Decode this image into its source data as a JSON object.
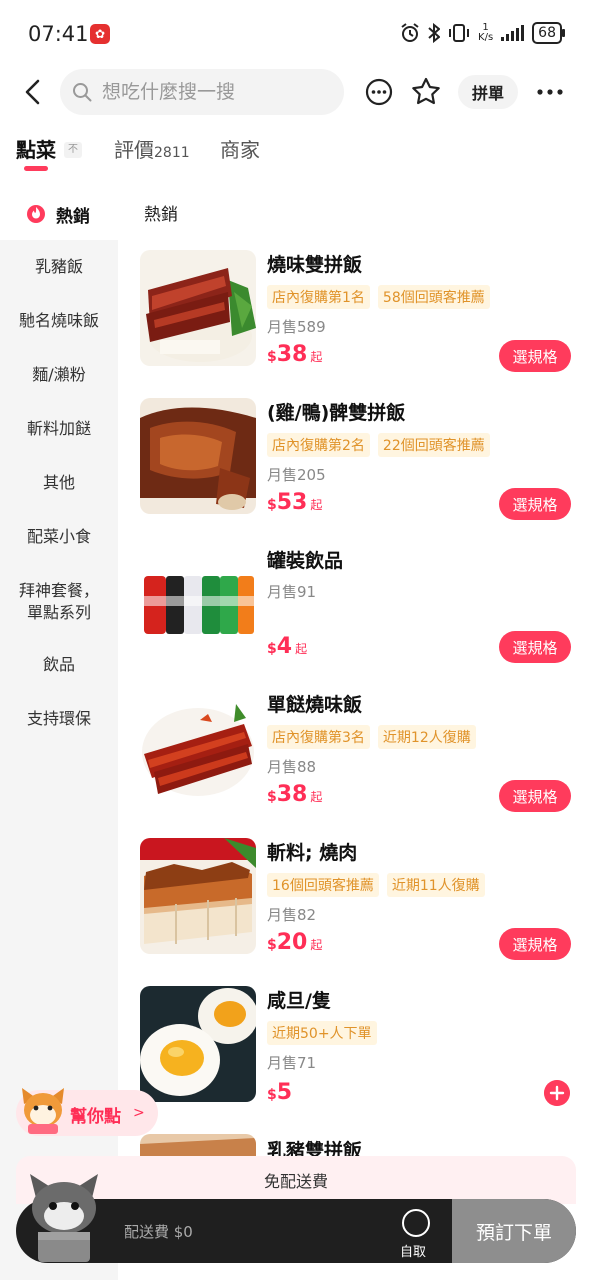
{
  "status": {
    "time": "07:41",
    "net_speed_top": "1",
    "net_speed_bottom": "K/s",
    "battery": "68"
  },
  "header": {
    "search_placeholder": "想吃什麼搜一搜",
    "group_button": "拼單"
  },
  "tabs": {
    "order": "點菜",
    "order_badge": "不",
    "reviews": "評價",
    "reviews_count": "2811",
    "merchant": "商家"
  },
  "sidebar": {
    "hot": "熱銷",
    "items": [
      "乳豬飯",
      "馳名燒味飯",
      "麵/瀨粉",
      "斬料加餸",
      "其他",
      "配菜小食",
      "拜神套餐，",
      "單點系列",
      "飲品",
      "支持環保"
    ]
  },
  "section_title": "熱銷",
  "products": [
    {
      "name": "燒味雙拼飯",
      "tags": [
        "店內復購第1名",
        "58個回頭客推薦"
      ],
      "sales": "月售589",
      "currency": "$",
      "price": "38",
      "suffix": "起",
      "action": "選規格"
    },
    {
      "name": "(雞/鴨)髀雙拼飯",
      "tags": [
        "店內復購第2名",
        "22個回頭客推薦"
      ],
      "sales": "月售205",
      "currency": "$",
      "price": "53",
      "suffix": "起",
      "action": "選規格"
    },
    {
      "name": "罐裝飲品",
      "tags": [],
      "sales": "月售91",
      "currency": "$",
      "price": "4",
      "suffix": "起",
      "action": "選規格"
    },
    {
      "name": "單餸燒味飯",
      "tags": [
        "店內復購第3名",
        "近期12人復購"
      ],
      "sales": "月售88",
      "currency": "$",
      "price": "38",
      "suffix": "起",
      "action": "選規格"
    },
    {
      "name": "斬料; 燒肉",
      "tags": [
        "16個回頭客推薦",
        "近期11人復購"
      ],
      "sales": "月售82",
      "currency": "$",
      "price": "20",
      "suffix": "起",
      "action": "選規格"
    },
    {
      "name": "咸旦/隻",
      "tags": [
        "近期50+人下單"
      ],
      "sales": "月售71",
      "currency": "$",
      "price": "5",
      "suffix": "",
      "action": ""
    },
    {
      "name": "乳豬雙拼飯",
      "tags": [],
      "sales": "",
      "currency": "",
      "price": "",
      "suffix": "",
      "action": ""
    }
  ],
  "helper": {
    "label": "幫你點"
  },
  "cart": {
    "free_delivery": "免配送費",
    "delivery_fee": "配送費 $0",
    "pickup": "自取",
    "checkout": "預訂下單"
  },
  "colors": {
    "accent": "#ff3b5c",
    "tag_bg": "#fff5e0",
    "tag_text": "#e0932a",
    "cart_bg": "#1f1f1f"
  }
}
